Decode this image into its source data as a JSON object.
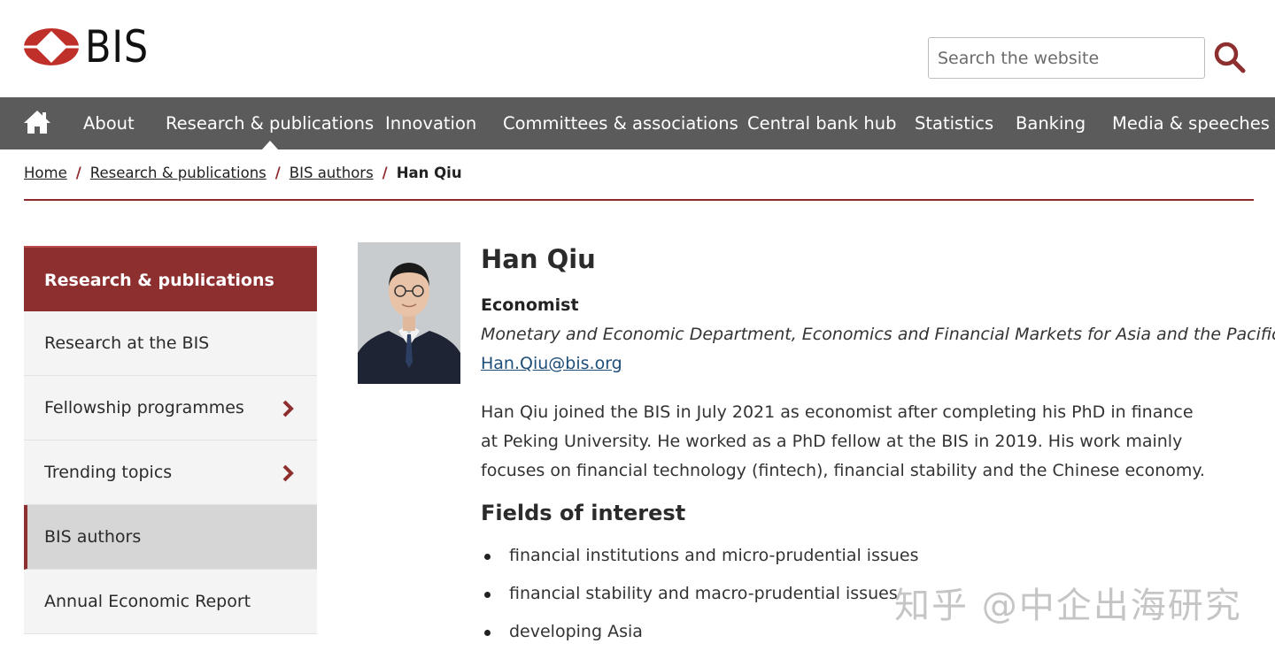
{
  "header": {
    "logo_text": "BIS",
    "search_placeholder": "Search the website"
  },
  "nav": {
    "home_icon": "home-icon",
    "items": [
      {
        "label": "About"
      },
      {
        "label": "Research & publications"
      },
      {
        "label": "Innovation"
      },
      {
        "label": "Committees & associations"
      },
      {
        "label": "Central bank hub"
      },
      {
        "label": "Statistics"
      },
      {
        "label": "Banking"
      },
      {
        "label": "Media & speeches"
      }
    ],
    "active": "Research & publications"
  },
  "breadcrumb": {
    "items": [
      "Home",
      "Research & publications",
      "BIS authors"
    ],
    "current": "Han Qiu",
    "separator": "/"
  },
  "sidebar": {
    "heading": "Research & publications",
    "items": [
      {
        "label": "Research at the BIS"
      },
      {
        "label": "Fellowship programmes",
        "icon": "chevron-right-icon"
      },
      {
        "label": "Trending topics",
        "icon": "chevron-right-icon"
      },
      {
        "label": "BIS authors"
      },
      {
        "label": "Annual Economic Report"
      }
    ],
    "active": "BIS authors"
  },
  "profile": {
    "name": "Han Qiu",
    "role": "Economist",
    "department": "Monetary and Economic Department, Economics and Financial Markets for Asia and the Pacific",
    "email": "Han.Qiu@bis.org",
    "bio": "Han Qiu joined the BIS in July 2021 as economist after completing his PhD in finance at Peking University. He worked as a PhD fellow at the BIS in 2019. His work mainly focuses on financial technology (fintech), financial stability and the Chinese economy.",
    "fields_title": "Fields of interest",
    "fields": [
      "financial institutions and micro-prudential issues",
      "financial stability and macro-prudential issues",
      "developing Asia"
    ]
  },
  "watermark": "知乎 @中企出海研究",
  "colors": {
    "brand_red": "#8d2f2f",
    "nav_bg": "#5b5b5b",
    "active_side_bg": "#d6d6d6"
  }
}
